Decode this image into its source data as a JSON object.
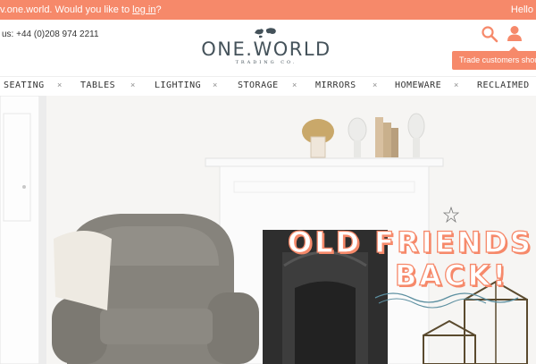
{
  "topbar": {
    "message_prefix": "v.one.world. Would you like to ",
    "login_link": "log in",
    "message_suffix": "?",
    "hello": "Hello"
  },
  "header": {
    "phone": "us: +44 (0)208 974 2211",
    "logo_name": "ONE.WORLD",
    "logo_sub": "TRADING CO.",
    "search_icon": "search-icon",
    "user_icon": "user-icon",
    "tooltip": "Trade customers should"
  },
  "nav": {
    "items": [
      "SEATING",
      "TABLES",
      "LIGHTING",
      "STORAGE",
      "MIRRORS",
      "HOMEWARE",
      "RECLAIMED"
    ],
    "separator": "×"
  },
  "hero": {
    "line1": "OLD FRIENDS",
    "line2": "BACK!"
  },
  "colors": {
    "accent": "#f6896a",
    "logo": "#44525a"
  }
}
